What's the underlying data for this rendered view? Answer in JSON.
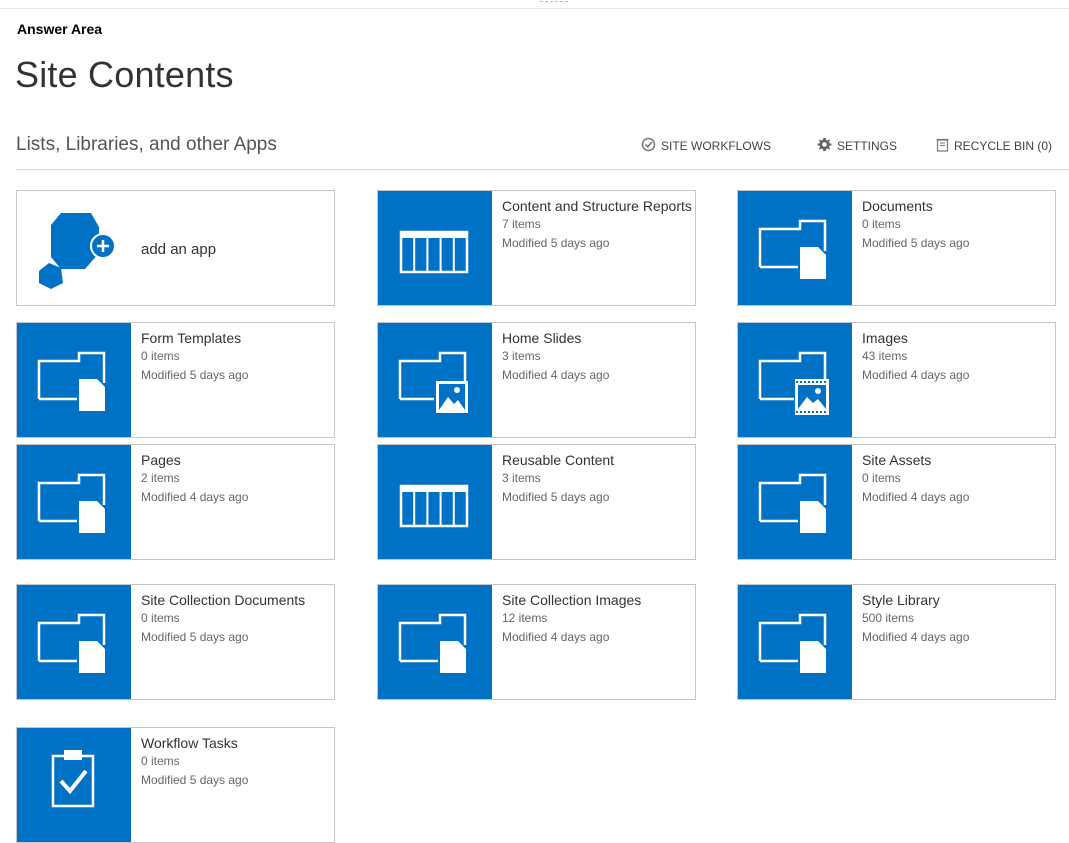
{
  "header": {
    "answer_area": "Answer Area",
    "page_title": "Site Contents",
    "section_heading": "Lists, Libraries, and other Apps"
  },
  "actions": {
    "site_workflows": "SITE WORKFLOWS",
    "settings": "SETTINGS",
    "recycle_bin": "RECYCLE BIN (0)"
  },
  "add_app": {
    "label": "add an app",
    "icon": "add-app-icon"
  },
  "tiles": [
    {
      "name": "Content and Structure Reports",
      "count": "7 items",
      "modified": "Modified 5 days ago",
      "icon": "list-icon"
    },
    {
      "name": "Documents",
      "count": "0 items",
      "modified": "Modified 5 days ago",
      "icon": "document-library-icon"
    },
    {
      "name": "Form Templates",
      "count": "0 items",
      "modified": "Modified 5 days ago",
      "icon": "document-library-icon"
    },
    {
      "name": "Home Slides",
      "count": "3 items",
      "modified": "Modified 4 days ago",
      "icon": "picture-library-icon"
    },
    {
      "name": "Images",
      "count": "43 items",
      "modified": "Modified 4 days ago",
      "icon": "asset-library-icon"
    },
    {
      "name": "Pages",
      "count": "2 items",
      "modified": "Modified 4 days ago",
      "icon": "document-library-icon"
    },
    {
      "name": "Reusable Content",
      "count": "3 items",
      "modified": "Modified 5 days ago",
      "icon": "list-icon"
    },
    {
      "name": "Site Assets",
      "count": "0 items",
      "modified": "Modified 4 days ago",
      "icon": "document-library-icon"
    },
    {
      "name": "Site Collection Documents",
      "count": "0 items",
      "modified": "Modified 5 days ago",
      "icon": "document-library-icon"
    },
    {
      "name": "Site Collection Images",
      "count": "12 items",
      "modified": "Modified 4 days ago",
      "icon": "document-library-icon"
    },
    {
      "name": "Style Library",
      "count": "500 items",
      "modified": "Modified 4 days ago",
      "icon": "document-library-icon"
    },
    {
      "name": "Workflow Tasks",
      "count": "0 items",
      "modified": "Modified 5 days ago",
      "icon": "task-list-icon"
    }
  ],
  "colors": {
    "tile_blue": "#0072c6",
    "tile_border": "#c6c6c6",
    "text_dark": "#333333",
    "text_meta": "#666666"
  }
}
